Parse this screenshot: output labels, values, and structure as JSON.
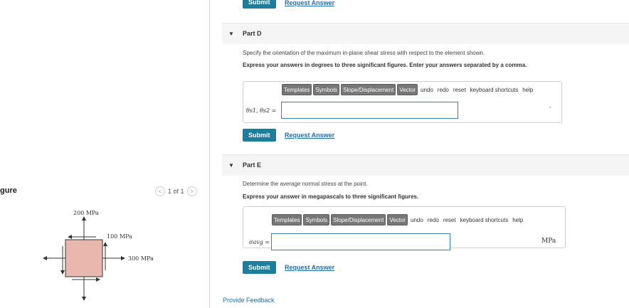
{
  "figure": {
    "title": "gure",
    "pager_text": "1 of 1",
    "labels": {
      "top_stress": "200 MPa",
      "shear_stress": "100 MPa",
      "right_stress": "300 MPa"
    },
    "colors": {
      "element_fill": "#e8b7ad"
    }
  },
  "top": {
    "submit_label": "Submit",
    "request_answer_label": "Request Answer"
  },
  "part_d": {
    "title": "Part D",
    "instruction": "Specify the orientation of the maximum in-plane shear stress with respect to the element shown.",
    "instruction_bold": "Express your answers in degrees to three significant figures. Enter your answers separated by a comma.",
    "toolbar": {
      "templates": "Templates",
      "symbols": "Symbols",
      "slope": "Slope/Displacement",
      "vector": "Vector",
      "undo": "undo",
      "redo": "redo",
      "reset": "reset",
      "shortcuts": "keyboard shortcuts",
      "help": "help"
    },
    "eq_label": "θs1, θs2 =",
    "answer_value": "",
    "unit_mark": "∘",
    "submit_label": "Submit",
    "request_answer_label": "Request Answer"
  },
  "part_e": {
    "title": "Part E",
    "instruction": "Determine the average normal stress at the point.",
    "instruction_bold": "Express your answer in megapascals to three significant figures.",
    "toolbar": {
      "templates": "Templates",
      "symbols": "Symbols",
      "slope": "Slope/Displacement",
      "vector": "Vector",
      "undo": "undo",
      "redo": "redo",
      "reset": "reset",
      "shortcuts": "keyboard shortcuts",
      "help": "help"
    },
    "eq_label": "σavg =",
    "answer_value": "",
    "unit": "MPa",
    "submit_label": "Submit",
    "request_answer_label": "Request Answer"
  },
  "footer": {
    "feedback_label": "Provide Feedback"
  }
}
